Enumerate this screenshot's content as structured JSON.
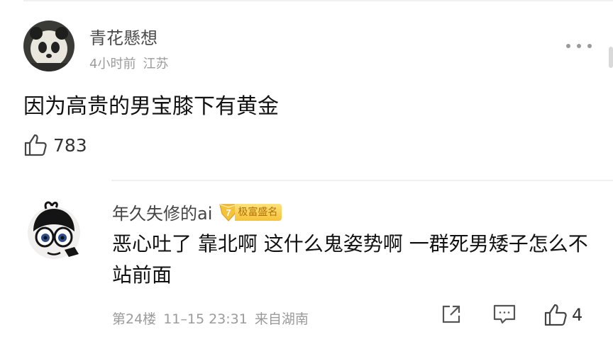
{
  "comments": [
    {
      "username": "青花懸想",
      "time": "4小时前",
      "location": "江苏",
      "content": "因为高贵的男宝膝下有黄金",
      "likes": "783"
    }
  ],
  "reply": {
    "username": "年久失修的ai",
    "badge_level": "7",
    "badge_label": "极富盛名",
    "content": "恶心吐了 靠北啊 这什么鬼姿势啊 一群死男矮子怎么不站前面",
    "floor": "第24楼",
    "datetime": "11–15 23:31",
    "origin": "来自湖南",
    "likes": "4"
  },
  "icons": {
    "like": "thumbs-up-icon",
    "share": "share-icon",
    "reply": "comment-icon",
    "more": "more-dots-icon",
    "badge": "level-shield-icon"
  },
  "colors": {
    "badge_gold": "#f5c33b",
    "muted_text": "#9b9b9b"
  }
}
